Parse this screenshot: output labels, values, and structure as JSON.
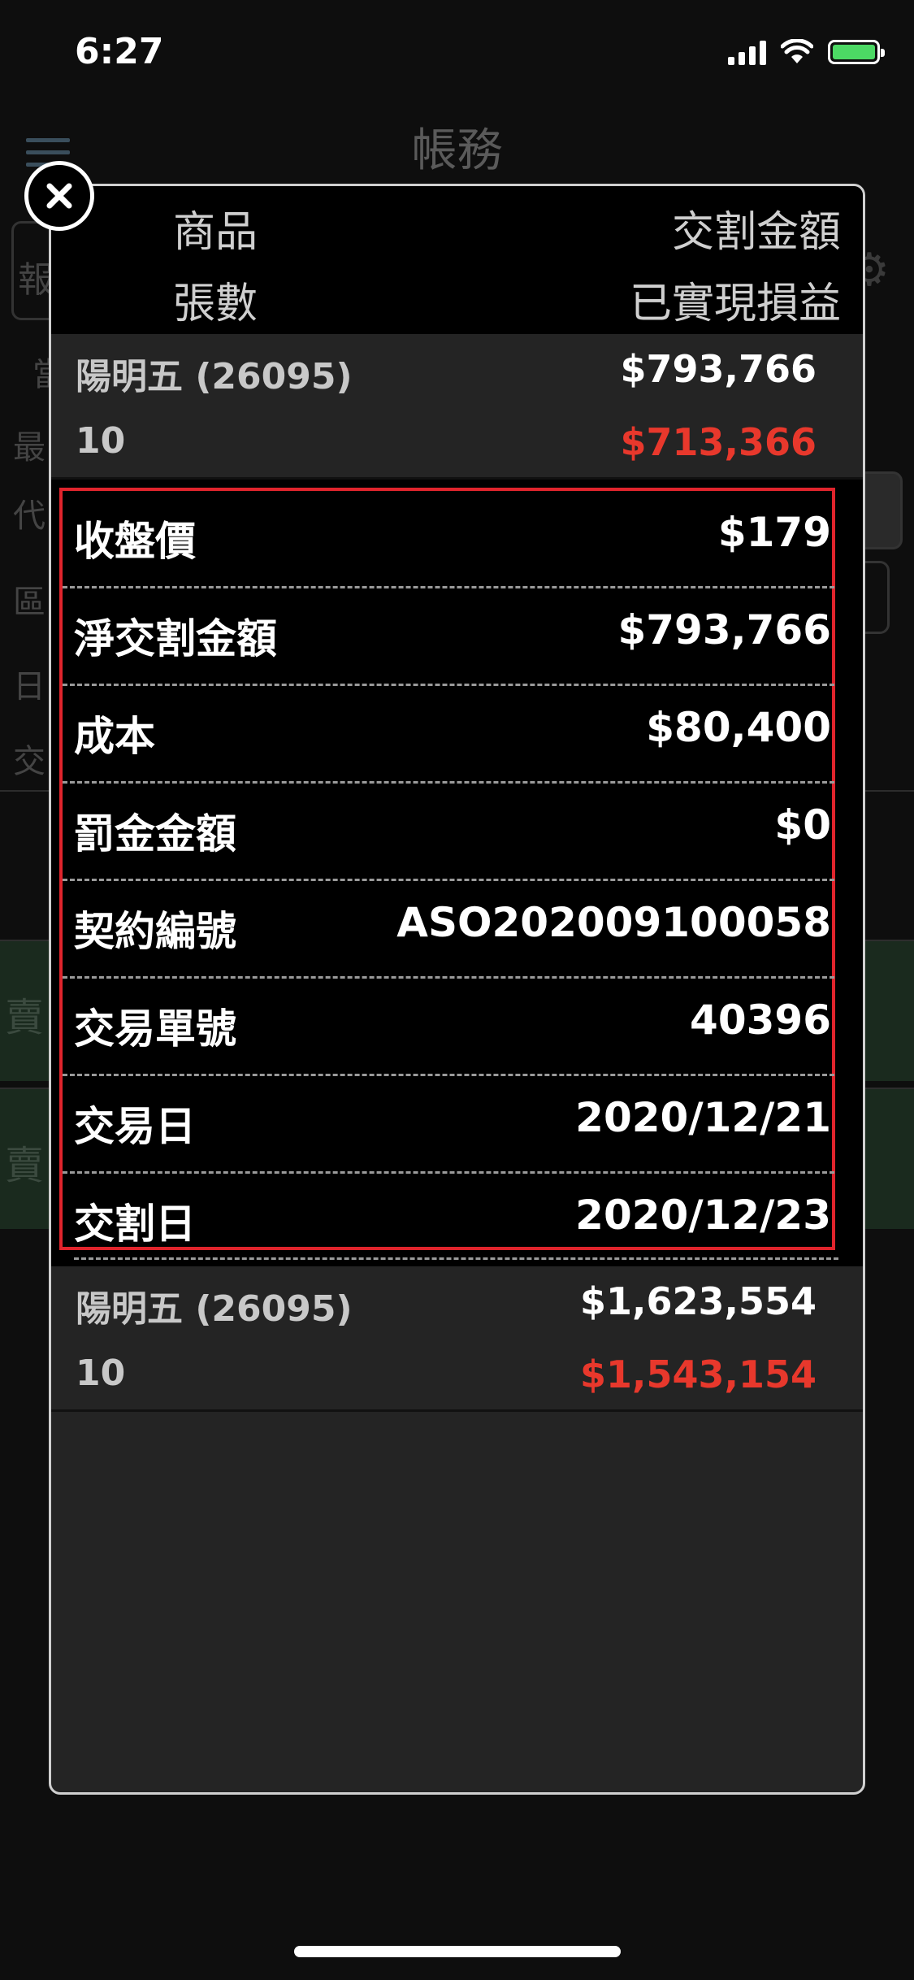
{
  "status_bar": {
    "time": "6:27"
  },
  "background": {
    "title": "帳務",
    "left_labels": [
      "報",
      "當",
      "最",
      "代",
      "區",
      "日",
      "交"
    ],
    "row_labels": [
      "賣",
      "賣"
    ]
  },
  "modal": {
    "header": {
      "col1_top": "商品",
      "col2_top": "交割金額",
      "col1_bottom": "張數",
      "col2_bottom": "已實現損益"
    },
    "orders": [
      {
        "name": "陽明五 (26095)",
        "amount": "$793,766",
        "qty": "10",
        "pnl": "$713,366"
      },
      {
        "name": "陽明五 (26095)",
        "amount": "$1,623,554",
        "qty": "10",
        "pnl": "$1,543,154"
      }
    ],
    "details": [
      {
        "label": "收盤價",
        "value": "$179"
      },
      {
        "label": "淨交割金額",
        "value": "$793,766"
      },
      {
        "label": "成本",
        "value": "$80,400"
      },
      {
        "label": "罰金金額",
        "value": "$0"
      },
      {
        "label": "契約編號",
        "value": "ASO202009100058"
      },
      {
        "label": "交易單號",
        "value": "40396"
      },
      {
        "label": "交易日",
        "value": "2020/12/21"
      },
      {
        "label": "交割日",
        "value": "2020/12/23"
      }
    ]
  },
  "colors": {
    "loss_profit": "#e8382c",
    "highlight_border": "#e0242c",
    "battery": "#4cd964"
  }
}
